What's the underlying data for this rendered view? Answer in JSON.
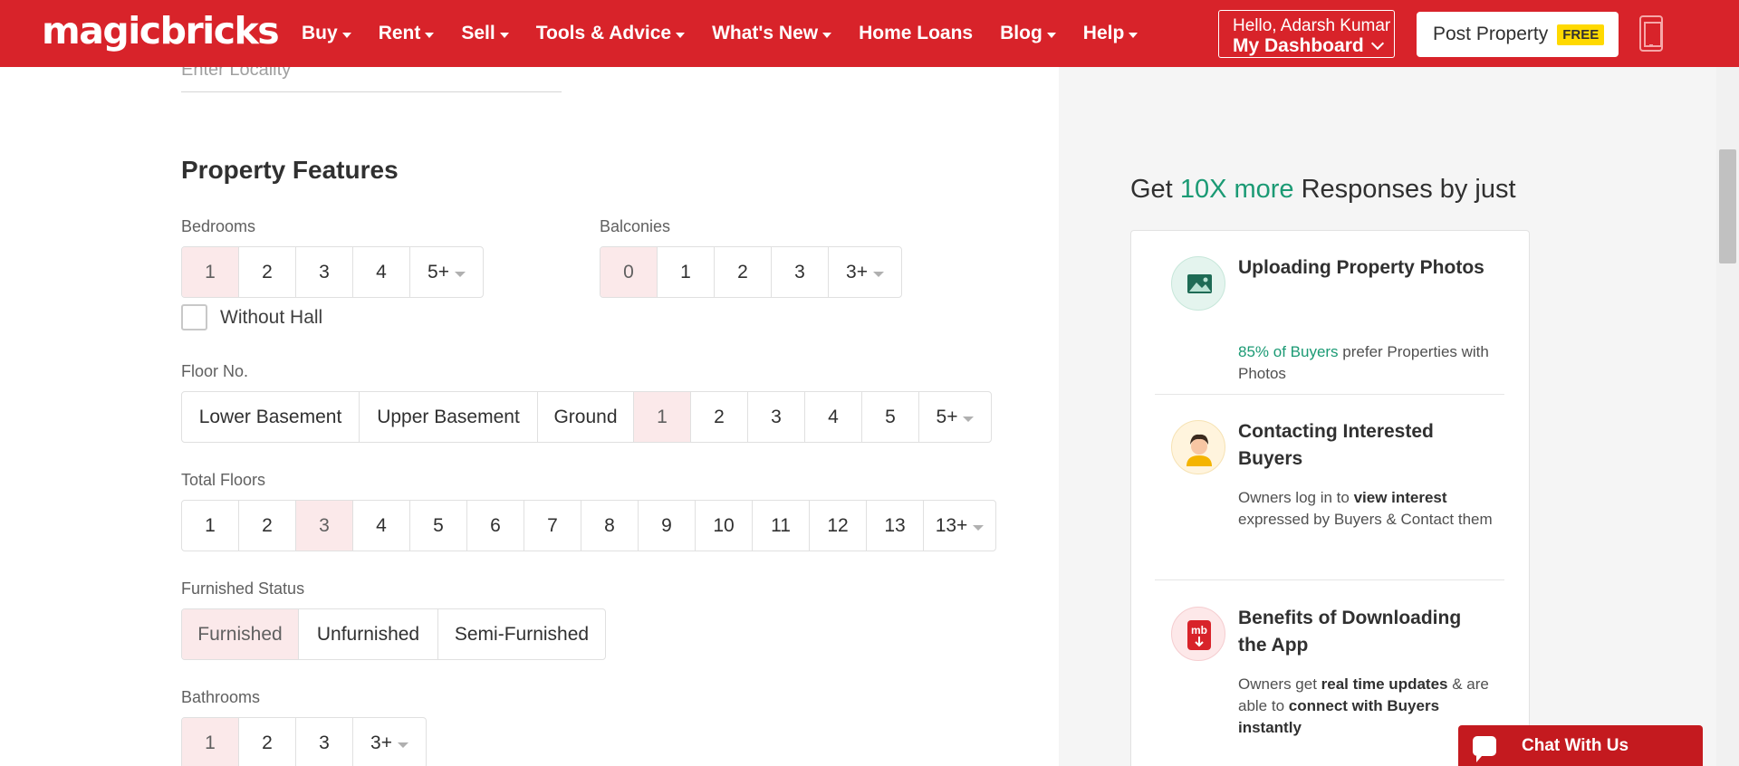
{
  "header": {
    "logo": "magicbricks",
    "nav": [
      "Buy",
      "Rent",
      "Sell",
      "Tools & Advice",
      "What's New",
      "Home Loans",
      "Blog",
      "Help"
    ],
    "greeting": "Hello, Adarsh Kumar",
    "dashboard": "My Dashboard",
    "post_property": "Post Property",
    "free_badge": "FREE",
    "brand_color": "#d8232a"
  },
  "form": {
    "locality_placeholder": "Enter Locality",
    "section_title": "Property Features",
    "bedrooms": {
      "label": "Bedrooms",
      "options": [
        "1",
        "2",
        "3",
        "4",
        "5+"
      ],
      "selected": "1"
    },
    "without_hall": {
      "label": "Without Hall",
      "checked": false
    },
    "balconies": {
      "label": "Balconies",
      "options": [
        "0",
        "1",
        "2",
        "3",
        "3+"
      ],
      "selected": "0"
    },
    "floor_no": {
      "label": "Floor No.",
      "options": [
        "Lower Basement",
        "Upper Basement",
        "Ground",
        "1",
        "2",
        "3",
        "4",
        "5",
        "5+"
      ],
      "selected": "1"
    },
    "total_floors": {
      "label": "Total Floors",
      "options": [
        "1",
        "2",
        "3",
        "4",
        "5",
        "6",
        "7",
        "8",
        "9",
        "10",
        "11",
        "12",
        "13",
        "13+"
      ],
      "selected": "3"
    },
    "furnished": {
      "label": "Furnished Status",
      "options": [
        "Furnished",
        "Unfurnished",
        "Semi-Furnished"
      ],
      "selected": "Furnished"
    },
    "bathrooms": {
      "label": "Bathrooms",
      "options": [
        "1",
        "2",
        "3",
        "3+"
      ],
      "selected": "1"
    }
  },
  "promo": {
    "title_pre": "Get ",
    "title_accent": "10X more",
    "title_post": " Responses by just",
    "accent_color": "#1b9a74",
    "features": [
      {
        "title": "Uploading Property Photos",
        "desc_highlight": "85% of Buyers",
        "desc": " prefer Properties with Photos"
      },
      {
        "title": "Contacting Interested Buyers",
        "desc_pre": "Owners log in to ",
        "desc_bold": "view interest",
        "desc_post": " expressed by Buyers & Contact them"
      },
      {
        "title": "Benefits of Downloading the App",
        "desc_pre": "Owners get ",
        "desc_bold1": "real time updates",
        "desc_mid": " & are able to ",
        "desc_bold2": "connect with Buyers instantly",
        "icon_text": "mb"
      }
    ]
  },
  "chat": {
    "label": "Chat With Us"
  }
}
